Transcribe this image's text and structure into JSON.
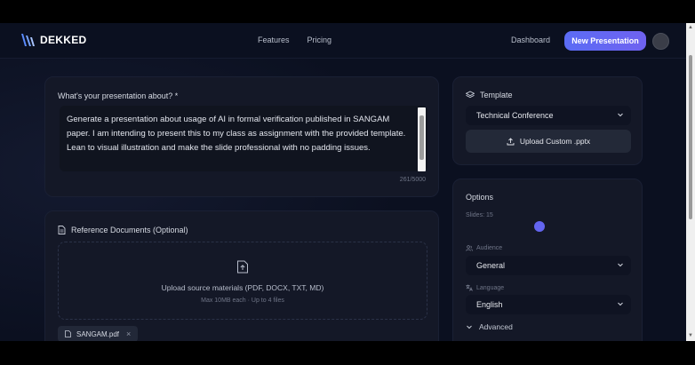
{
  "brand": {
    "name": "DEKKED"
  },
  "nav": {
    "features": "Features",
    "pricing": "Pricing",
    "dashboard": "Dashboard",
    "new_presentation": "New Presentation"
  },
  "prompt": {
    "label": "What's your presentation about? *",
    "text": "Generate a presentation about usage of AI in formal verification published in SANGAM paper. I am intending to present this to my class as assignment with the provided template. Lean to visual illustration and make the slide professional with no padding issues.",
    "counter": "261/5000"
  },
  "reference": {
    "title": "Reference Documents (Optional)",
    "upload_text": "Upload source materials (PDF, DOCX, TXT, MD)",
    "upload_hint": "Max 10MB each · Up to 4 files",
    "files": [
      {
        "name": "SANGAM.pdf"
      }
    ]
  },
  "template": {
    "title": "Template",
    "selected": "Technical Conference",
    "upload_button": "Upload Custom .pptx"
  },
  "options": {
    "title": "Options",
    "slides_label": "Slides: 15",
    "slides_value": 15,
    "audience_label": "Audience",
    "audience_value": "General",
    "language_label": "Language",
    "language_value": "English",
    "advanced_label": "Advanced"
  },
  "colors": {
    "accent": "#5b6cf5",
    "card": "#141827",
    "background": "#0b1020"
  }
}
